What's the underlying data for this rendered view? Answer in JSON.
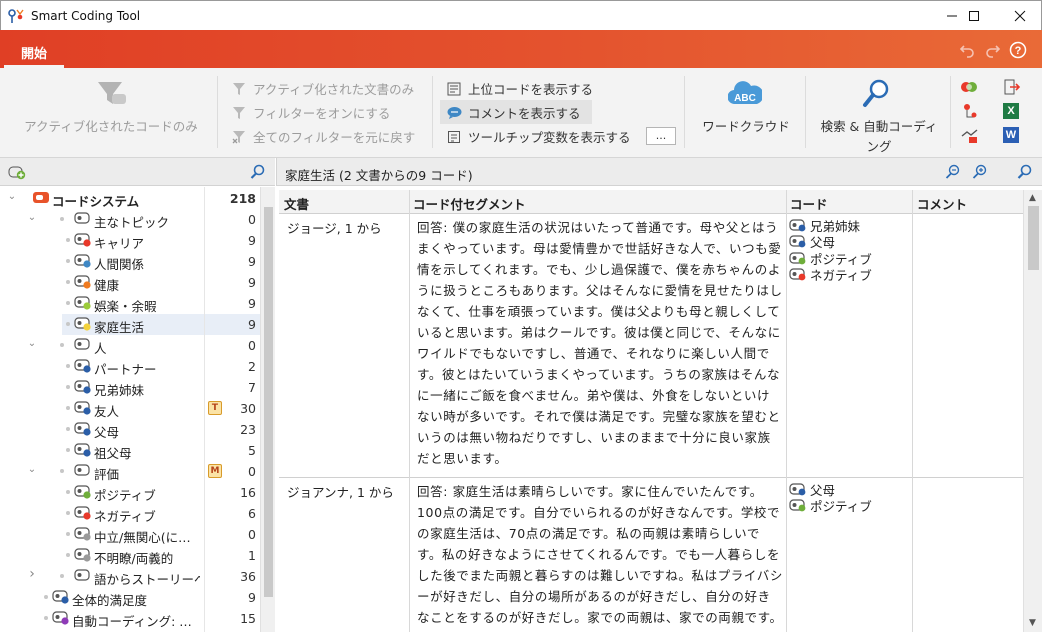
{
  "window": {
    "title": "Smart Coding Tool"
  },
  "tabs": {
    "active": "開始"
  },
  "ribbon": {
    "active_codes_only": "アクティブ化されたコードのみ",
    "active_docs_only": "アクティブ化された文書のみ",
    "filter_on": "フィルターをオンにする",
    "reset_filters": "全てのフィルターを元に戻す",
    "show_parent_codes": "上位コードを表示する",
    "show_comments": "コメントを表示する",
    "show_tooltip_vars": "ツールチップ変数を表示する",
    "dots_button": "...",
    "word_cloud": "ワードクラウド",
    "search_autocode_1": "検索 & 自動コーディ",
    "search_autocode_2": "ング",
    "abc_icon_text": "ABC",
    "excel_letter": "X",
    "word_letter": "W"
  },
  "code_tree": {
    "root": {
      "label": "コードシステム",
      "count": "218"
    },
    "rows": [
      {
        "label": "主なトピック",
        "count": "0"
      },
      {
        "label": "キャリア",
        "count": "9",
        "color": "#e8392a"
      },
      {
        "label": "人間関係",
        "count": "9",
        "color": "#3f88c5"
      },
      {
        "label": "健康",
        "count": "9",
        "color": "#f07b20"
      },
      {
        "label": "娯楽・余暇",
        "count": "9",
        "color": "#9ccc3a"
      },
      {
        "label": "家庭生活",
        "count": "9",
        "color": "#f3d23c"
      },
      {
        "label": "人",
        "count": "0"
      },
      {
        "label": "パートナー",
        "count": "2",
        "color": "#2b5ea7"
      },
      {
        "label": "兄弟姉妹",
        "count": "7",
        "color": "#2b5ea7"
      },
      {
        "label": "友人",
        "count": "30",
        "color": "#2b5ea7",
        "badge": "T"
      },
      {
        "label": "父母",
        "count": "23",
        "color": "#2b5ea7"
      },
      {
        "label": "祖父母",
        "count": "5",
        "color": "#2b5ea7"
      },
      {
        "label": "評価",
        "count": "0",
        "badge": "M"
      },
      {
        "label": "ポジティブ",
        "count": "16",
        "color": "#6fae3b"
      },
      {
        "label": "ネガティブ",
        "count": "6",
        "color": "#e8392a"
      },
      {
        "label": "中立/無関心(に…",
        "count": "0",
        "color": "#9a9a9a"
      },
      {
        "label": "不明瞭/両義的",
        "count": "1",
        "color": "#9a9a9a"
      },
      {
        "label": "語からストーリーへ…",
        "count": "36"
      },
      {
        "label": "全体的満足度",
        "count": "9",
        "color": "#2b5ea7"
      },
      {
        "label": "自動コーディング: …",
        "count": "15",
        "color": "#8e3bb7"
      }
    ]
  },
  "segments_view": {
    "title": "家庭生活 (2 文書からの9 コード)",
    "columns": {
      "doc": "文書",
      "segment": "コード付セグメント",
      "code": "コード",
      "comment": "コメント"
    },
    "rows": [
      {
        "doc": "ジョージ, 1 から",
        "segment": "回答: 僕の家庭生活の状況はいたって普通です。母や父とはうまくやっています。母は愛情豊かで世話好きな人で、いつも愛情を示してくれます。でも、少し過保護で、僕を赤ちゃんのように扱うところもあります。父はそんなに愛情を見せたりはしなくて、仕事を頑張っています。僕は父よりも母と親しくしていると思います。弟はクールです。彼は僕と同じで、そんなにワイルドでもないですし、普通で、それなりに楽しい人間です。彼とはたいていうまくやっています。うちの家族はそんなに一緒にご飯を食べません。弟や僕は、外食をしないといけない時が多いです。それで僕は満足です。完璧な家族を望むというのは無い物ねだりですし、いまのままで十分に良い家族だと思います。",
        "codes": [
          {
            "label": "兄弟姉妹",
            "color": "#2b5ea7"
          },
          {
            "label": "父母",
            "color": "#2b5ea7"
          },
          {
            "label": "ポジティブ",
            "color": "#6fae3b"
          },
          {
            "label": "ネガティブ",
            "color": "#e8392a"
          }
        ]
      },
      {
        "doc": "ジョアンナ, 1 から",
        "segment": "回答: 家庭生活は素晴らしいです。家に住んでいたんです。100点の満足です。自分でいられるのが好きなんです。学校での家庭生活は、70点の満足です。私の両親は素晴らしいです。私の好きなようにさせてくれるんです。でも一人暮らしをした後でまた両親と暮らすのは難しいですね。私はプライバシーが好きだし、自分の場所があるのが好きだし、自分の好きなことをするのが好きだし。家での両親は、家での両親です。",
        "codes": [
          {
            "label": "父母",
            "color": "#2b5ea7"
          },
          {
            "label": "ポジティブ",
            "color": "#6fae3b"
          }
        ]
      }
    ]
  }
}
